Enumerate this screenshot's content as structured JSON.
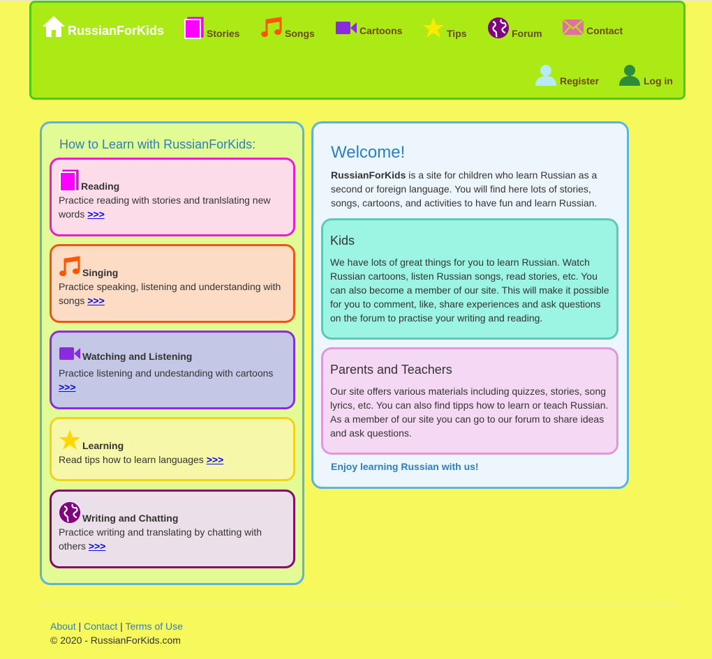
{
  "nav": {
    "brand": "RussianForKids",
    "items": [
      {
        "label": "Stories",
        "icon": "book-icon",
        "color": "#ff00ff"
      },
      {
        "label": "Songs",
        "icon": "music-note-icon",
        "color": "#ff5500"
      },
      {
        "label": "Cartoons",
        "icon": "video-camera-icon",
        "color": "#8a2be2"
      },
      {
        "label": "Tips",
        "icon": "star-icon",
        "color": "#ffe000"
      },
      {
        "label": "Forum",
        "icon": "globe-icon",
        "color": "#800080"
      },
      {
        "label": "Contact",
        "icon": "envelope-icon",
        "color": "#e26fa0"
      }
    ],
    "register": "Register",
    "login": "Log in"
  },
  "left": {
    "title": "How to Learn with RussianForKids:",
    "cards": [
      {
        "title": "Reading",
        "text": "Practice reading with stories and tranlslating new words",
        "more": ">>>"
      },
      {
        "title": "Singing",
        "text": "Practice speaking, listening and understanding with songs",
        "more": ">>>"
      },
      {
        "title": "Watching and Listening",
        "text": "Practice listening and undestanding with cartoons",
        "more": ">>>"
      },
      {
        "title": "Learning",
        "text": "Read tips how to learn languages",
        "more": ">>>"
      },
      {
        "title": "Writing and Chatting",
        "text": "Practice writing and translating by chatting with others",
        "more": ">>>"
      }
    ]
  },
  "right": {
    "welcome": "Welcome!",
    "intro_bold": "RussianForKids",
    "intro_rest": " is a site for children who learn Russian as a second or foreign language. You will find here lots of  stories, songs, cartoons, and activities to have fun and learn Russian.",
    "kids_title": "Kids",
    "kids_text": "We have lots of great things for you to learn Russian. Watch Russian cartoons, listen Russian songs, read stories, etc. You can also become a member of our site. This will make it possible for you to comment, like, share experiences and ask questions on the forum to practise your writing and reading.",
    "parents_title": "Parents and Teachers",
    "parents_text": "Our site offers various materials including quizzes, stories, song lyrics, etc. You can also find tipps how to learn or teach Russian. As a member of our site you can go to our forum to share ideas and ask questions.",
    "enjoy": "Enjoy learning Russian with us!"
  },
  "footer": {
    "about": "About",
    "contact": "Contact",
    "terms": "Terms of Use",
    "sep": "|",
    "copyright": "© 2020 - RussianForKids.com"
  }
}
